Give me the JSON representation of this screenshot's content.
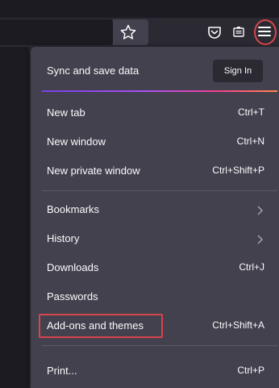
{
  "colors": {
    "accent_red": "#d6464d",
    "menu_bg": "#42414d",
    "text": "#fbfbfe"
  },
  "toolbar": {
    "bookmark_star": "star-icon",
    "pocket": "pocket-icon",
    "extension": "extension-icon",
    "menu_button": "hamburger-menu-icon"
  },
  "menu": {
    "sync_label": "Sync and save data",
    "sign_in": "Sign In",
    "items": [
      {
        "label": "New tab",
        "shortcut": "Ctrl+T"
      },
      {
        "label": "New window",
        "shortcut": "Ctrl+N"
      },
      {
        "label": "New private window",
        "shortcut": "Ctrl+Shift+P"
      },
      {
        "label": "Bookmarks",
        "shortcut": ""
      },
      {
        "label": "History",
        "shortcut": ""
      },
      {
        "label": "Downloads",
        "shortcut": "Ctrl+J"
      },
      {
        "label": "Passwords",
        "shortcut": ""
      },
      {
        "label": "Add-ons and themes",
        "shortcut": "Ctrl+Shift+A"
      },
      {
        "label": "Print...",
        "shortcut": "Ctrl+P"
      }
    ]
  }
}
